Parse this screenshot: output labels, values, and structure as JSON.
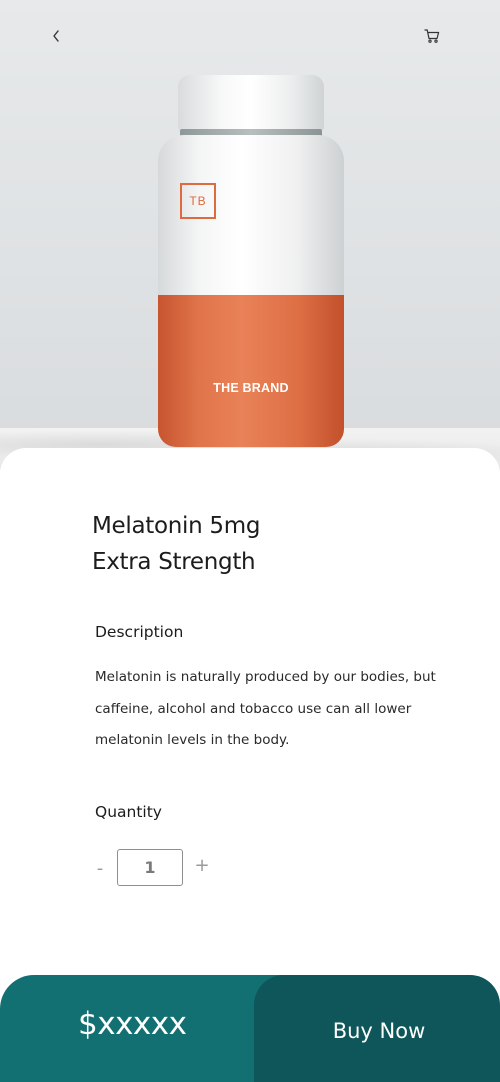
{
  "header": {
    "back_icon": "chevron-left-icon",
    "cart_icon": "shopping-cart-icon"
  },
  "product_image": {
    "logo_text": "TB",
    "brand_text": "THE BRAND",
    "accent_color": "#e06a3f"
  },
  "product": {
    "title_line1": "Melatonin 5mg",
    "title_line2": "Extra Strength"
  },
  "description": {
    "label": "Description",
    "text": "Melatonin is naturally produced by our bodies, but caffeine, alcohol and tobacco use can all lower melatonin levels in the body."
  },
  "quantity": {
    "label": "Quantity",
    "minus": "-",
    "plus": "+",
    "value": "1"
  },
  "footer": {
    "price": "$xxxxx",
    "buy_label": "Buy Now",
    "price_color": "#127072",
    "button_color": "#0e5659"
  }
}
